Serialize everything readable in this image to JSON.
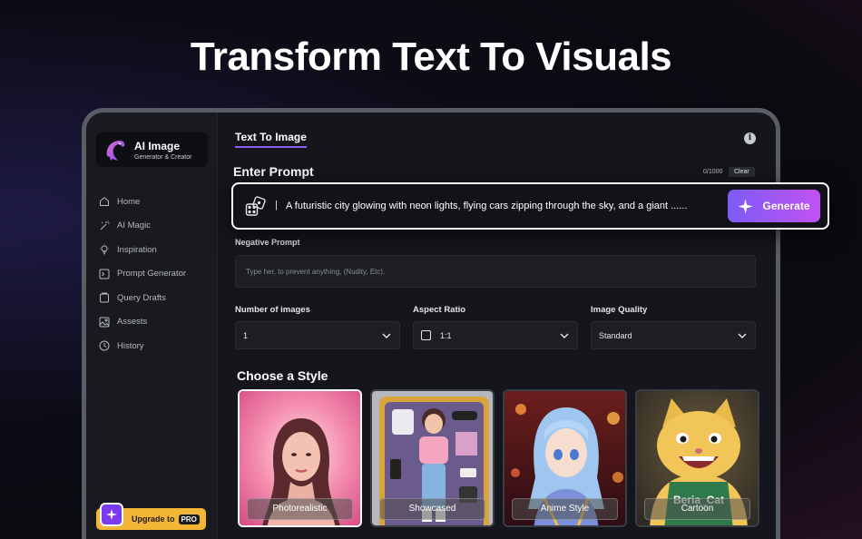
{
  "headline": "Transform Text To Visuals",
  "brand": {
    "name": "AI Image",
    "tagline": "Generator & Creator"
  },
  "sidebar": {
    "items": [
      {
        "label": "Home",
        "icon": "home-icon"
      },
      {
        "label": "AI Magic",
        "icon": "magic-wand-icon"
      },
      {
        "label": "Inspiration",
        "icon": "lightbulb-icon"
      },
      {
        "label": "Prompt Generator",
        "icon": "terminal-icon"
      },
      {
        "label": "Query Drafts",
        "icon": "drafts-icon"
      },
      {
        "label": "Assests",
        "icon": "image-icon"
      },
      {
        "label": "History",
        "icon": "clock-icon"
      }
    ],
    "upgrade_label": "Upgrade to",
    "upgrade_badge": "PRO"
  },
  "main": {
    "tab": "Text To Image",
    "enter_prompt": "Enter Prompt",
    "char_count": "0/1000",
    "clear_label": "Clear",
    "prompt_cursor": "|",
    "prompt_text": "A futuristic city glowing with neon lights, flying cars zipping through the sky, and a giant ......",
    "generate_label": "Generate",
    "negative_label": "Negative Prompt",
    "negative_placeholder": "Type her, to prevent anything, (Nudity, Etc).",
    "fields": [
      {
        "label": "Number of images",
        "value": "1"
      },
      {
        "label": "Aspect Ratio",
        "value": "1:1"
      },
      {
        "label": "Image Quality",
        "value": "Standard"
      }
    ],
    "style_title": "Choose a Style",
    "styles": [
      {
        "label": "Photorealistic"
      },
      {
        "label": "Showcased"
      },
      {
        "label": "Anime Style"
      },
      {
        "label": "Cartoon",
        "sign_text": "Beria_Cat"
      }
    ]
  },
  "colors": {
    "accent": "#8b5cf6",
    "generate_start": "#7c5cf6",
    "generate_end": "#c152f2",
    "upgrade": "#f2b534"
  }
}
